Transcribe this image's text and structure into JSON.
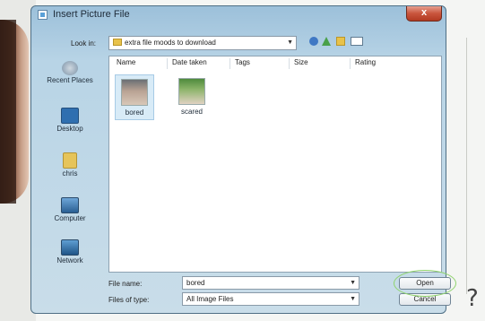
{
  "dialog": {
    "title": "Insert Picture File",
    "close_symbol": "x"
  },
  "look_in": {
    "label": "Look in:",
    "value": "extra file moods to download"
  },
  "nav_icons": [
    "back-icon",
    "up-folder-icon",
    "new-folder-icon",
    "views-menu-icon"
  ],
  "places": [
    {
      "label": "Recent Places",
      "icon": "recent-places-icon"
    },
    {
      "label": "Desktop",
      "icon": "desktop-icon"
    },
    {
      "label": "chris",
      "icon": "user-folder-icon"
    },
    {
      "label": "Computer",
      "icon": "computer-icon"
    },
    {
      "label": "Network",
      "icon": "network-icon"
    }
  ],
  "columns": [
    "Name",
    "Date taken",
    "Tags",
    "Size",
    "Rating"
  ],
  "files": [
    {
      "name": "bored",
      "selected": true
    },
    {
      "name": "scared",
      "selected": false
    }
  ],
  "file_name": {
    "label": "File name:",
    "value": "bored"
  },
  "file_type": {
    "label": "Files of type:",
    "value": "All Image Files"
  },
  "buttons": {
    "open": "Open",
    "cancel": "Cancel"
  },
  "background": {
    "question_mark": "?"
  },
  "colors": {
    "title_gradient_top": "#9cc0da",
    "selection": "#d8ebf7",
    "close_button": "#c9553d",
    "highlight_ring": "#8fd36d"
  }
}
